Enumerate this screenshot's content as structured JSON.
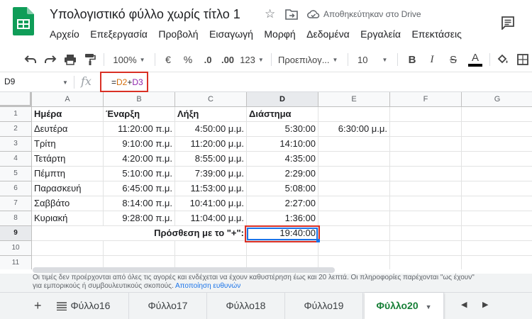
{
  "header": {
    "doc_title": "Υπολογιστικό φύλλο χωρίς τίτλο 1",
    "saved_status": "Αποθηκεύτηκαν στο Drive",
    "brand_color": "#0f9d58"
  },
  "menu": [
    "Αρχείο",
    "Επεξεργασία",
    "Προβολή",
    "Εισαγωγή",
    "Μορφή",
    "Δεδομένα",
    "Εργαλεία",
    "Επεκτάσεις"
  ],
  "toolbar": {
    "zoom": "100%",
    "currency": "€",
    "percent": "%",
    "decrease_decimals": ".0",
    "increase_decimals": ".00",
    "more_formats": "123",
    "font": "Προεπιλογ...",
    "font_size": "10",
    "bold": "B",
    "italic": "I",
    "strikethrough": "S",
    "text_color": "A"
  },
  "formula_bar": {
    "cell_ref": "D9",
    "fx": "fx",
    "formula_prefix": "=",
    "ref1": "D2",
    "operator": "+",
    "ref2": "D3"
  },
  "grid": {
    "columns": [
      "A",
      "B",
      "C",
      "D",
      "E",
      "F",
      "G"
    ],
    "rows": [
      "1",
      "2",
      "3",
      "4",
      "5",
      "6",
      "7",
      "8",
      "9",
      "10",
      "11"
    ],
    "header_row": [
      "Ημέρα",
      "Έναρξη",
      "Λήξη",
      "Διάστημα"
    ],
    "data": [
      [
        "Δευτέρα",
        "11:20:00 π.μ.",
        "4:50:00 μ.μ.",
        "5:30:00",
        "6:30:00 μ.μ."
      ],
      [
        "Τρίτη",
        "9:10:00 π.μ.",
        "11:20:00 μ.μ.",
        "14:10:00",
        ""
      ],
      [
        "Τετάρτη",
        "4:20:00 π.μ.",
        "8:55:00 μ.μ.",
        "4:35:00",
        ""
      ],
      [
        "Πέμπτη",
        "5:10:00 π.μ.",
        "7:39:00 μ.μ.",
        "2:29:00",
        ""
      ],
      [
        "Παρασκευή",
        "6:45:00 π.μ.",
        "11:53:00 μ.μ.",
        "5:08:00",
        ""
      ],
      [
        "Σαββάτο",
        "8:14:00 π.μ.",
        "10:41:00 μ.μ.",
        "2:27:00",
        ""
      ],
      [
        "Κυριακή",
        "9:28:00 π.μ.",
        "11:04:00 μ.μ.",
        "1:36:00",
        ""
      ]
    ],
    "sum_label": "Πρόσθεση με το \"+\":",
    "sum_value": "19:40:00"
  },
  "disclaimer": {
    "line1": "Οι τιμές δεν προέρχονται από όλες τις αγορές και ενδέχεται να έχουν καθυστέρηση έως και 20 λεπτά. Οι πληροφορίες παρέχονται \"ως έχουν\"",
    "line2": "για εμπορικούς ή συμβουλευτικούς σκοπούς.",
    "link": "Αποποίηση ευθυνών"
  },
  "sheets": {
    "add": "+",
    "tabs": [
      "Φύλλο16",
      "Φύλλο17",
      "Φύλλο18",
      "Φύλλο19",
      "Φύλλο20"
    ],
    "active_index": 4,
    "active_color": "#188038"
  },
  "highlight_color": "#d93025",
  "selection_color": "#1a73e8"
}
